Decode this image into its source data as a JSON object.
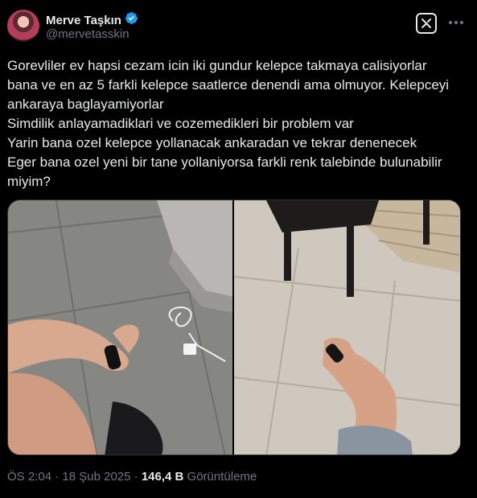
{
  "author": {
    "display_name": "Merve Taşkın",
    "handle": "@mervetasskin",
    "verified": true
  },
  "icons": {
    "verified": "verified-badge-icon",
    "grok": "grok-icon",
    "more": "more-icon"
  },
  "colors": {
    "background": "#000000",
    "text": "#e7e9ea",
    "secondary_text": "#71767b",
    "verified_blue": "#1d9bf0"
  },
  "tweet": {
    "lines": [
      "Gorevliler ev hapsi cezam icin iki gundur kelepce takmaya calisiyorlar",
      "bana ve en az 5 farkli kelepce saatlerce denendi ama olmuyor. Kelepceyi",
      "ankaraya baglayamiyorlar",
      "Simdilik anlayamadiklari ve cozemedikleri bir problem var",
      "Yarin bana ozel kelepce yollanacak ankaradan ve tekrar denenecek",
      "Eger bana ozel yeni bir tane yollaniyorsa farkli renk talebinde bulunabilir",
      "miyim?"
    ]
  },
  "meta": {
    "time": "ÖS 2:04",
    "separator": " · ",
    "date": "18 Şub 2025",
    "views_count": "146,4 B",
    "views_label": "Görüntüleme"
  }
}
